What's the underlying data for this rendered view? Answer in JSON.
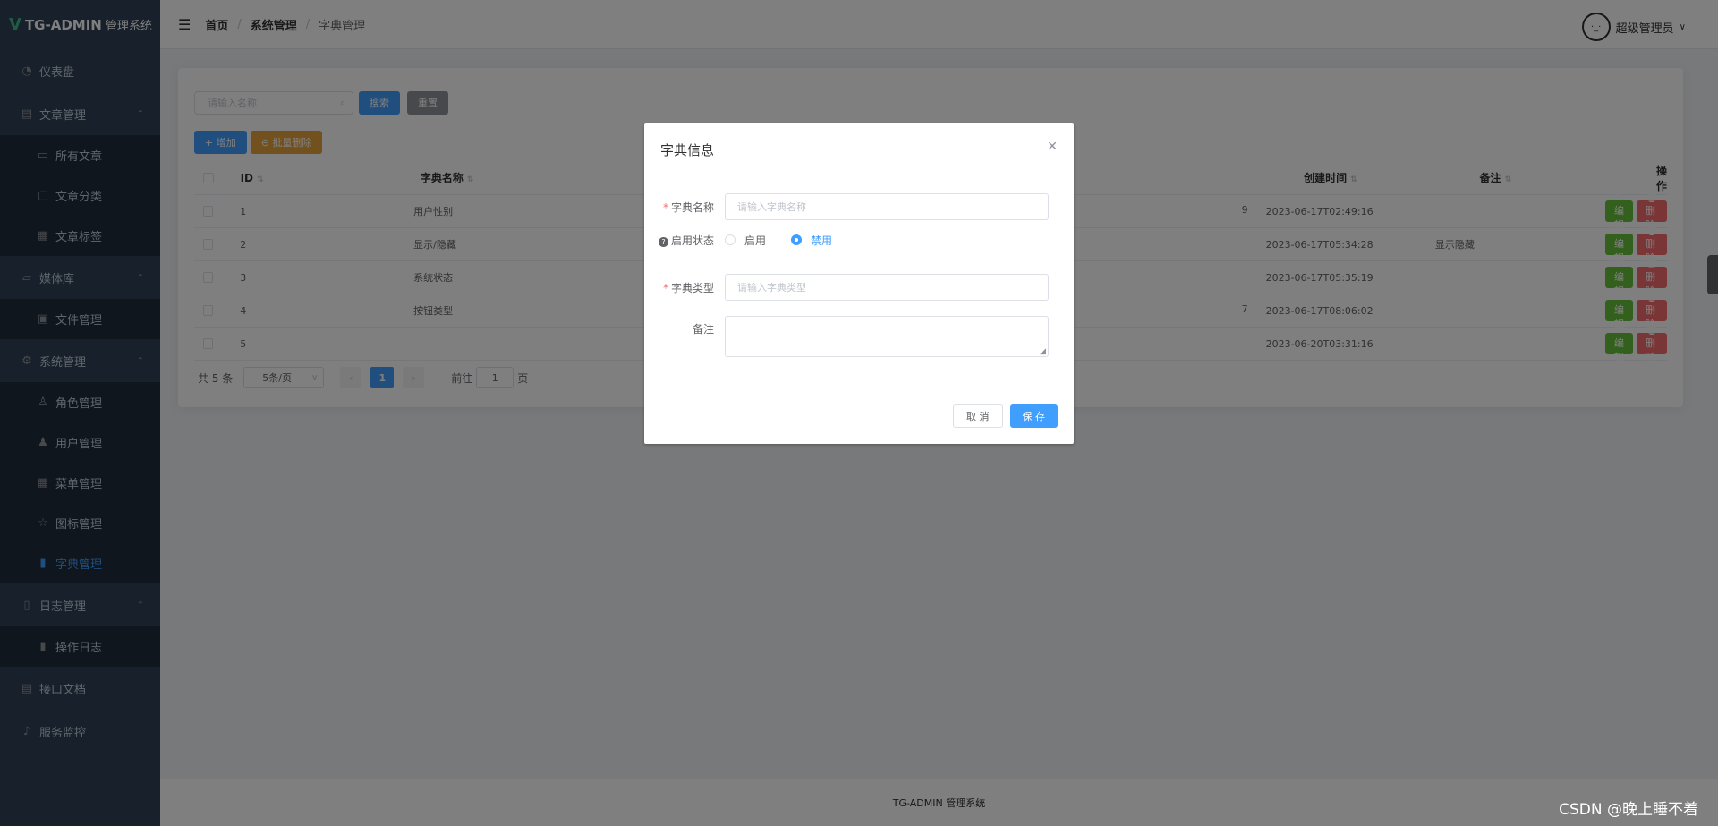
{
  "brand": {
    "logo": "V",
    "title": "TG-ADMIN",
    "subtitle": "管理系统"
  },
  "sidebar": {
    "items": [
      {
        "label": "仪表盘",
        "icon": "dashboard-icon",
        "type": "menu"
      },
      {
        "label": "文章管理",
        "icon": "document-icon",
        "type": "group"
      },
      {
        "label": "所有文章",
        "icon": "book-icon",
        "type": "sub"
      },
      {
        "label": "文章分类",
        "icon": "lock-icon",
        "type": "sub"
      },
      {
        "label": "文章标签",
        "icon": "grid-icon",
        "type": "sub"
      },
      {
        "label": "媒体库",
        "icon": "folder-icon",
        "type": "group"
      },
      {
        "label": "文件管理",
        "icon": "picture-icon",
        "type": "sub"
      },
      {
        "label": "系统管理",
        "icon": "gear-icon",
        "type": "group"
      },
      {
        "label": "角色管理",
        "icon": "user-outline-icon",
        "type": "sub"
      },
      {
        "label": "用户管理",
        "icon": "user-icon",
        "type": "sub"
      },
      {
        "label": "菜单管理",
        "icon": "menu-grid-icon",
        "type": "sub"
      },
      {
        "label": "图标管理",
        "icon": "star-icon",
        "type": "sub"
      },
      {
        "label": "字典管理",
        "icon": "bar-chart-icon",
        "type": "sub",
        "active": true
      },
      {
        "label": "日志管理",
        "icon": "notebook-icon",
        "type": "group"
      },
      {
        "label": "操作日志",
        "icon": "bar-chart-icon",
        "type": "sub"
      },
      {
        "label": "接口文档",
        "icon": "doc-icon",
        "type": "menu"
      },
      {
        "label": "服务监控",
        "icon": "bell-icon",
        "type": "menu"
      }
    ]
  },
  "header": {
    "breadcrumb": [
      "首页",
      "系统管理",
      "字典管理"
    ],
    "user_name": "超级管理员"
  },
  "toolbar": {
    "search_placeholder": "请输入名称",
    "search_label": "搜索",
    "reset_label": "重置",
    "add_label": "+ 增加",
    "batch_delete_label": "⊖ 批量删除"
  },
  "table": {
    "headers": {
      "id": "ID",
      "name": "字典名称",
      "time": "创建时间",
      "remark": "备注",
      "op": "操作"
    },
    "rows": [
      {
        "id": "1",
        "name": "用户性别",
        "extra": "9",
        "time": "2023-06-17T02:49:16",
        "remark": ""
      },
      {
        "id": "2",
        "name": "显示/隐藏",
        "extra": "",
        "time": "2023-06-17T05:34:28",
        "remark": "显示隐藏"
      },
      {
        "id": "3",
        "name": "系统状态",
        "extra": "",
        "time": "2023-06-17T05:35:19",
        "remark": ""
      },
      {
        "id": "4",
        "name": "按钮类型",
        "extra": "7",
        "time": "2023-06-17T08:06:02",
        "remark": ""
      },
      {
        "id": "5",
        "name": "",
        "extra": "",
        "time": "2023-06-20T03:31:16",
        "remark": ""
      }
    ],
    "edit_label": "✎ 编辑",
    "delete_label": "🗑 删除"
  },
  "pager": {
    "total": "共 5 条",
    "page_size": "5条/页",
    "current": "1",
    "goto_prefix": "前往",
    "goto_value": "1",
    "goto_suffix": "页"
  },
  "dialog": {
    "title": "字典信息",
    "name_label": "字典名称",
    "name_placeholder": "请输入字典名称",
    "status_label": "启用状态",
    "status_options": [
      "启用",
      "禁用"
    ],
    "status_selected": "禁用",
    "type_label": "字典类型",
    "type_placeholder": "请输入字典类型",
    "remark_label": "备注",
    "cancel_label": "取 消",
    "save_label": "保 存"
  },
  "footer": {
    "text": "TG-ADMIN 管理系统"
  },
  "watermark": "CSDN @晚上睡不着",
  "colors": {
    "sidebar_bg": "#304156",
    "primary": "#409eff",
    "success": "#67c23a",
    "danger": "#f56c6c",
    "warning": "#e6a23c"
  }
}
